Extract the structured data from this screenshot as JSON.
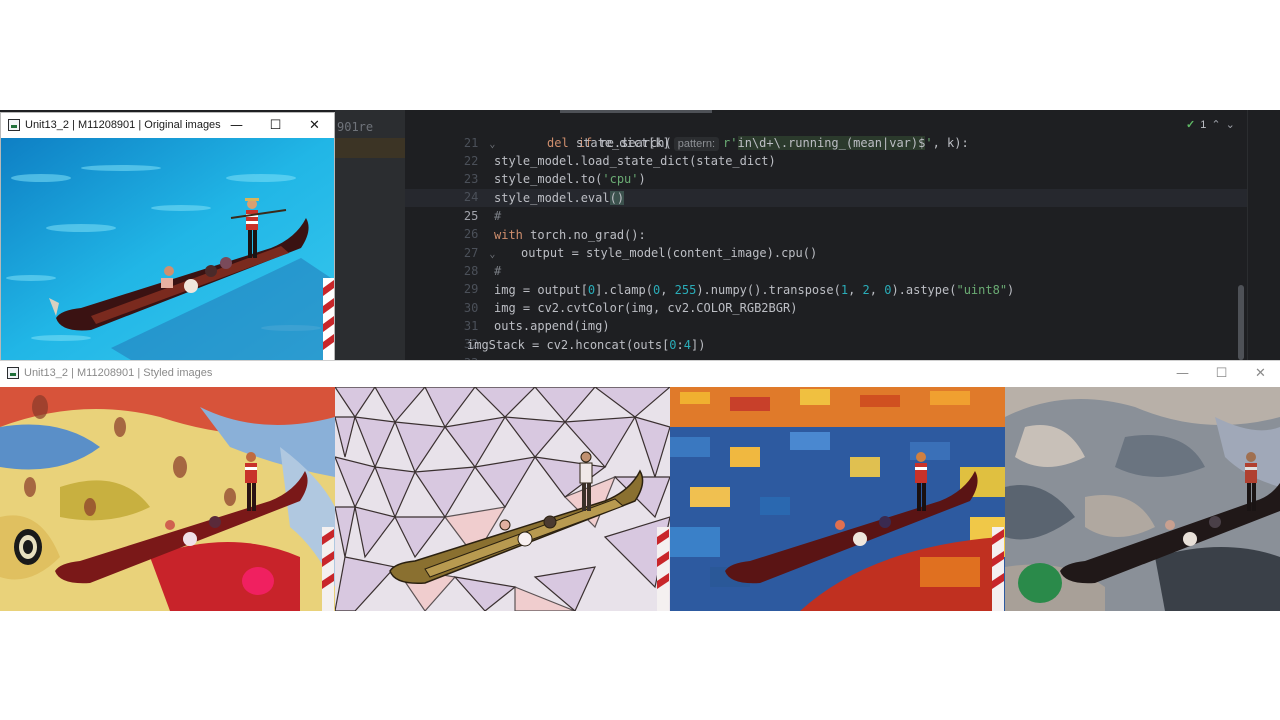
{
  "original_window": {
    "title": "Unit13_2 | M11208901 | Original images",
    "controls": {
      "minimize": "—",
      "maximize": "☐",
      "close": "✕"
    }
  },
  "styled_window": {
    "title": "Unit13_2 | M11208901 | Styled images",
    "controls": {
      "minimize": "—",
      "maximize": "☐",
      "close": "✕"
    },
    "panels": [
      "style-1",
      "style-2",
      "style-3",
      "style-4"
    ]
  },
  "ide": {
    "file_fragment": "901re",
    "inspections": {
      "ok_count": "1"
    },
    "active_line": "25",
    "lines": [
      {
        "n": "21",
        "code_a": "if",
        "code_b": " re.search(",
        "hint": "pattern:",
        "code_c": "r'",
        "code_rx": "in\\d+\\.running_(mean|var)$",
        "code_d": "'",
        "code_e": ", k):"
      },
      {
        "n": "22",
        "code": "del state_dict[k]"
      },
      {
        "n": "23",
        "code": "style_model.load_state_dict(state_dict)"
      },
      {
        "n": "24",
        "code_a": "style_model.to(",
        "code_str": "'cpu'",
        "code_b": ")"
      },
      {
        "n": "25",
        "code_a": "style_model.eval",
        "code_paren": "()"
      },
      {
        "n": "26",
        "code": "#"
      },
      {
        "n": "27",
        "code_kw": "with",
        "code": " torch.no_grad():"
      },
      {
        "n": "28",
        "code": "output = style_model(content_image).cpu()"
      },
      {
        "n": "29",
        "code": "#"
      },
      {
        "n": "30",
        "code_a": "img = output[",
        "n0": "0",
        "code_b": "].clamp(",
        "n1": "0",
        "code_c": ", ",
        "n2": "255",
        "code_d": ").numpy().transpose(",
        "n3": "1",
        "code_e": ", ",
        "n4": "2",
        "code_f": ", ",
        "n5": "0",
        "code_g": ").astype(",
        "code_str": "\"uint8\"",
        "code_h": ")"
      },
      {
        "n": "31",
        "code": "img = cv2.cvtColor(img, cv2.COLOR_RGB2BGR)"
      },
      {
        "n": "32",
        "code": "outs.append(img)"
      },
      {
        "n": "33",
        "code_a": "imgStack = cv2.hconcat(outs[",
        "n0": "0",
        "code_b": ":",
        "n1": "4",
        "code_c": "])"
      }
    ]
  },
  "colors": {
    "ide_bg": "#1e1f22",
    "keyword": "#cf8e6d",
    "string": "#6aab73",
    "number": "#2aacb8"
  }
}
